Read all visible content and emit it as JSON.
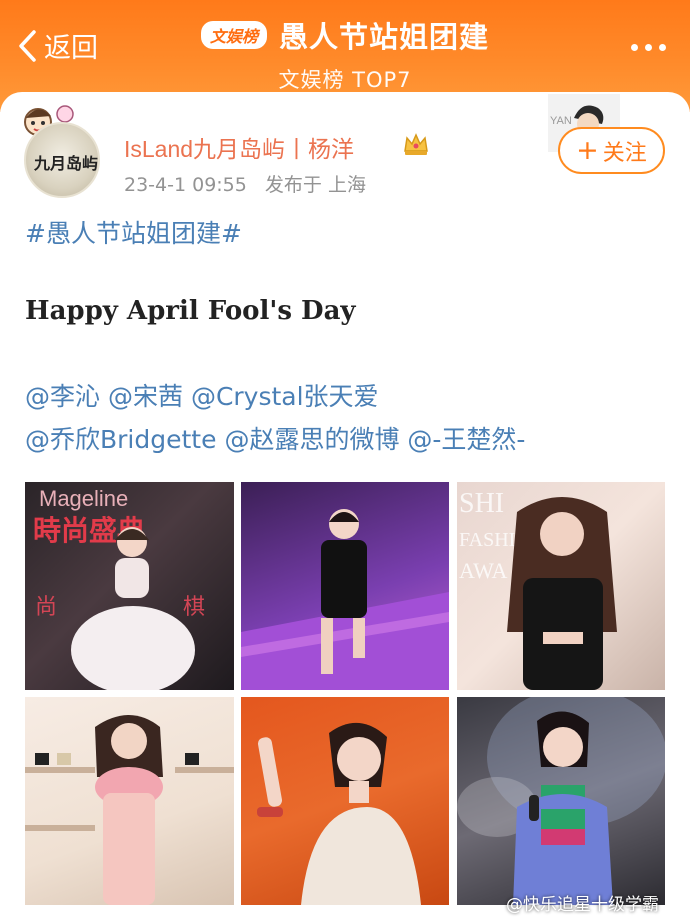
{
  "header": {
    "back_label": "返回",
    "badge": "文娱榜",
    "title": "愚人节站姐团建",
    "subtitle": "文娱榜 TOP7"
  },
  "post": {
    "username": "IsLand九月岛屿丨杨洋",
    "timestamp": "23-4-1 09:55",
    "location": "发布于 上海",
    "follow_label": "关注",
    "avatar_text": "九月岛屿",
    "follow_deco_text": "YAN",
    "hashtag": "#愚人节站姐团建#",
    "english_text": "Happy April Fool's Day",
    "mentions_line1": [
      "@李沁",
      "@宋茜",
      "@Crystal张天爱"
    ],
    "mentions_line2": [
      "@乔欣Bridgette",
      "@赵露思的微博",
      "@-王楚然-"
    ]
  },
  "images": [
    {
      "alt": "photo-1",
      "overlay": "Mageline 時尚盛典 尚 棋"
    },
    {
      "alt": "photo-2",
      "overlay": ""
    },
    {
      "alt": "photo-3",
      "overlay": "SHI FASHIO AWA"
    },
    {
      "alt": "photo-4",
      "overlay": ""
    },
    {
      "alt": "photo-5",
      "overlay": ""
    },
    {
      "alt": "photo-6",
      "overlay": ""
    }
  ],
  "watermark": "@快乐追星十级学霸",
  "colors": {
    "header_orange": "#ff7a1a",
    "username": "#eb7350",
    "link_blue": "#4a7fb5",
    "meta_gray": "#939393"
  }
}
